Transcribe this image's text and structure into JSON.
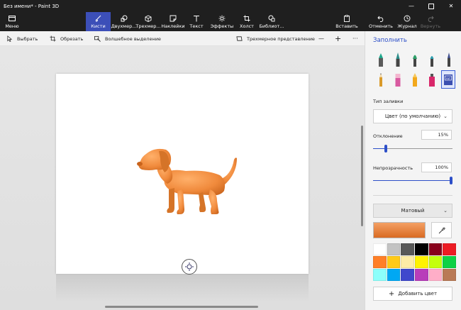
{
  "window": {
    "title": "Без имени* - Paint 3D",
    "minimize": "—",
    "close": "✕"
  },
  "ribbon": {
    "menu": "Меню",
    "tabs": [
      {
        "label": "Кисти",
        "icon": "brush-icon"
      },
      {
        "label": "Двухмер...",
        "icon": "shapes-2d-icon"
      },
      {
        "label": "Трехмер...",
        "icon": "cube-icon"
      },
      {
        "label": "Наклейки",
        "icon": "sticker-icon"
      },
      {
        "label": "Текст",
        "icon": "text-icon"
      },
      {
        "label": "Эффекты",
        "icon": "sun-icon"
      },
      {
        "label": "Холст",
        "icon": "canvas-icon"
      },
      {
        "label": "Библиот...",
        "icon": "library-icon"
      }
    ],
    "paste": "Вставить",
    "undo": "Отменить",
    "history": "Журнал",
    "redo": "Вернуть"
  },
  "toolbar": {
    "select": "Выбрать",
    "crop": "Обрезать",
    "magic_select": "Волшебное выделение",
    "view_3d": "Трехмерное представление",
    "zoom_out": "—",
    "zoom_in": "+",
    "more": "···"
  },
  "panel": {
    "title": "Заполнить",
    "brush_row1": [
      "marker-green",
      "calligraphy-pen",
      "oil-brush",
      "watercolor-brush",
      "pixel-pen"
    ],
    "brush_row2": [
      "pencil",
      "eraser",
      "crayon",
      "spray-can",
      "fill-bucket"
    ],
    "fill_type_label": "Тип заливки",
    "fill_type_value": "Цвет (по умолчанию)",
    "tolerance_label": "Отклонение",
    "tolerance_value": "15%",
    "tolerance": 0.15,
    "opacity_label": "Непрозрачность",
    "opacity_value": "100%",
    "opacity": 1.0,
    "material": "Матовый",
    "current_color": "#e8822e",
    "add_color": "Добавить цвет",
    "swatches": [
      "#ffffff",
      "#c3c3c3",
      "#585858",
      "#000000",
      "#88001b",
      "#ec1c24",
      "#ff7f27",
      "#ffca18",
      "#fdeca6",
      "#fff200",
      "#c4ff0e",
      "#0ed145",
      "#8cfffb",
      "#00a8f3",
      "#3f48cc",
      "#b83dba",
      "#ffaec8",
      "#b97a56"
    ]
  },
  "colors": {
    "accent": "#2d4fc8",
    "ribbon_active": "#3c4fb8",
    "dog": "#f08a3c"
  }
}
